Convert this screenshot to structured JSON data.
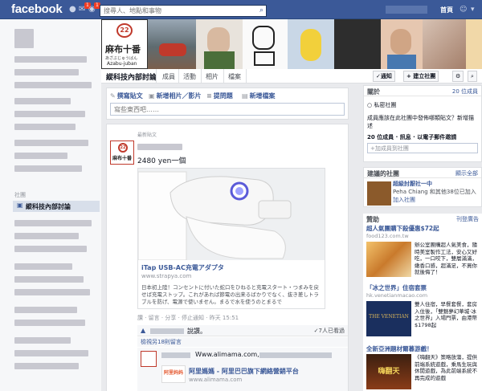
{
  "topbar": {
    "logo": "facebook",
    "search_placeholder": "搜尋人、地點和事物",
    "home": "首頁",
    "badges": [
      "1",
      "1"
    ]
  },
  "left": {
    "heading": "社團",
    "active_group": "縱科技內部討論"
  },
  "cover": {
    "sign_number": "22",
    "sign_kanji": "麻布十番",
    "sign_kana": "あざぶじゅうばん",
    "sign_english": "Azabu-juban"
  },
  "groupnav": {
    "name": "縱科技內部討論",
    "tabs": [
      "成員",
      "活動",
      "相片",
      "檔案"
    ],
    "notify": "✓通知",
    "new_group": "+ 建立社團"
  },
  "composer": {
    "tabs": [
      "撰寫貼文",
      "新增相片／影片",
      "提問題",
      "新增檔案"
    ],
    "placeholder": "寫些東西吧……"
  },
  "post": {
    "recent_label": "最新貼文",
    "avatar_text": "麻布十番",
    "text": "2480 yen一個",
    "link_title": "iTap USB-AC充電アダプタ",
    "link_url": "www.strapya.com",
    "link_desc": "日本初上陸！コンセントに付いた蛇口をひねると充電スタート・つまみを戻せば充電ストップ。これがあれば節電の出来るばかりでなく、抜き差しトラブルを防げ、電源で使いません。まるで水を使うのとまるで",
    "actions": "讚 · 留言 · 分享 · 停止通知 · 昨天 15:51",
    "like_text": "說讚。",
    "seen_text": "✓7人已看過",
    "view_comments": "檢視另18則留言",
    "comment_url": "Www.alimama.com,",
    "comment_logo": "阿里妈妈",
    "comment_title": "阿里媽媽 - 阿里巴巴旗下網絡營銷平台",
    "comment_link_url": "www.alimama.com"
  },
  "right": {
    "about_label": "關於",
    "member_count_link": "20 位成員",
    "privacy": "私密社團",
    "invite_line1": "成員應該在此社團中發佈哪類貼文？新增描述",
    "invite_line2": "20 位成員 · 訊息 · 以電子郵件邀請",
    "add_member": "+加成員到社團",
    "suggested_label": "建議的社團",
    "see_all": "顯示全部",
    "sugg_title": "超級討厭社一中",
    "sugg_sub": "Peha Chiang 和其他38位已加入",
    "sugg_join": "加入社團",
    "sponsored": "贊助",
    "create_ad": "刊登廣告",
    "ad1_title": "超人氣團購下殺優惠$72起",
    "ad1_url": "food123.com.tw",
    "ad1_text": "辦公室團購超人氣美食，隨時美室製作工法，安心又好吃，一口咬下，雙層滿滿，嫩香口感，超滿足，不買你就後悔了！",
    "ad2_title": "「冰之世界」住宿套票",
    "ad2_url": "hk.venetianmacao.com",
    "ad2_text": "雙人住宿，早餐套餐，套房入住後，「雙魅夢幻華城·冰之世界」入場門票，由港幣$1798起",
    "ad2_brand": "THE VENETIAN",
    "ad3_title": "全新亞洲題材爾暮游戲！",
    "ad3_text": "《嗨翻天》策略放蕩，提供前端系統遊戲，乘馬生玩與休閒遊戲，為此前端系統不再完成的遊戲",
    "ad3_brand": "嗨翻天"
  },
  "colors": {
    "brand": "#3b5998",
    "badge": "#f03d25"
  }
}
